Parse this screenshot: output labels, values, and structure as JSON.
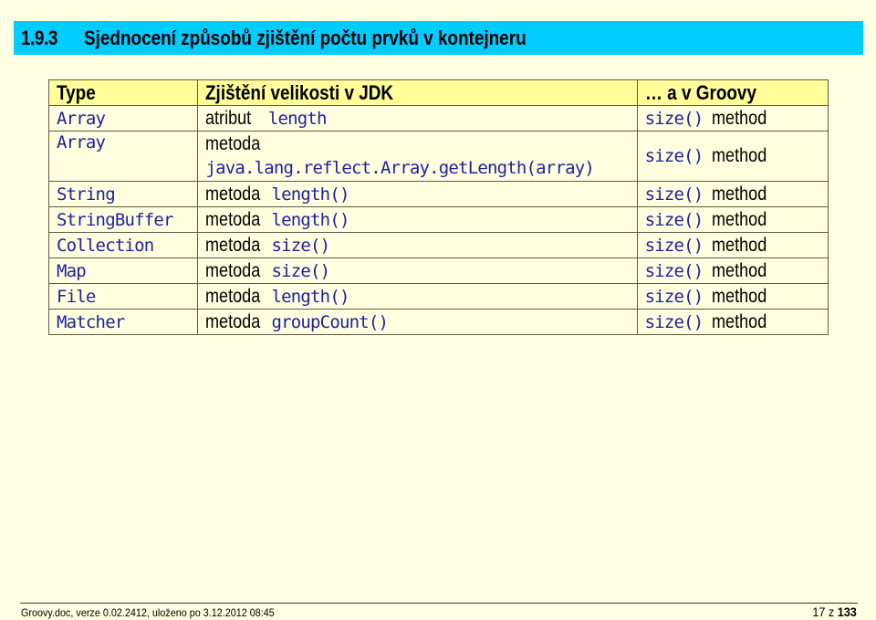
{
  "heading": {
    "number": "1.9.3",
    "title": "Sjednocení způsobů zjištění počtu prvků v kontejneru",
    "background_color": "#00CCFF"
  },
  "table": {
    "header_background": "#FFFF99",
    "body_background": "#FFFFE0",
    "code_color": "#1E1EA0",
    "columns": [
      "Type",
      "Zjištění velikosti v JDK",
      "… a v Groovy"
    ],
    "rows": [
      {
        "type": "Array",
        "jdk_prefix": "atribut",
        "jdk_code": "length",
        "groovy_code": "size()",
        "groovy_suffix": "method"
      },
      {
        "type": "Array",
        "jdk_prefix": "metoda",
        "jdk_code": "java.lang.reflect.Array.getLength(array)",
        "groovy_code": "size()",
        "groovy_suffix": "method"
      },
      {
        "type": "String",
        "jdk_prefix": "metoda",
        "jdk_code": "length()",
        "groovy_code": "size()",
        "groovy_suffix": "method"
      },
      {
        "type": "StringBuffer",
        "jdk_prefix": "metoda",
        "jdk_code": "length()",
        "groovy_code": "size()",
        "groovy_suffix": "method"
      },
      {
        "type": "Collection",
        "jdk_prefix": "metoda",
        "jdk_code": "size()",
        "groovy_code": "size()",
        "groovy_suffix": "method"
      },
      {
        "type": "Map",
        "jdk_prefix": "metoda",
        "jdk_code": "size()",
        "groovy_code": "size()",
        "groovy_suffix": "method"
      },
      {
        "type": "File",
        "jdk_prefix": "metoda",
        "jdk_code": "length()",
        "groovy_code": "size()",
        "groovy_suffix": "method"
      },
      {
        "type": "Matcher",
        "jdk_prefix": "metoda",
        "jdk_code": "groupCount()",
        "groovy_code": "size()",
        "groovy_suffix": "method"
      }
    ]
  },
  "footer": {
    "document_info": "Groovy.doc, verze 0.02.2412, uloženo po 3.12.2012 08:45",
    "page_current": "17",
    "page_separator": "z",
    "page_total": "133"
  }
}
